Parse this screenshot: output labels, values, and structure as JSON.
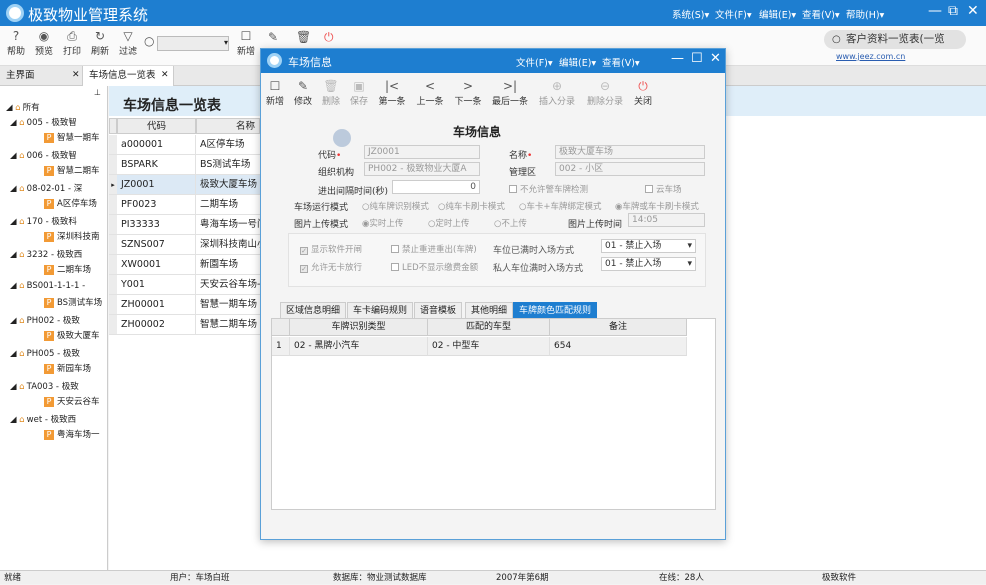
{
  "app": {
    "title": "极致物业管理系统"
  },
  "menu": {
    "system": "系统(S)▾",
    "file": "文件(F)▾",
    "edit": "编辑(E)▾",
    "view": "查看(V)▾",
    "help": "帮助(H)▾"
  },
  "window_controls": {
    "minimize": "—",
    "restore": "⧉",
    "close": "✕"
  },
  "toolbar": {
    "help": "帮助",
    "preview": "预览",
    "print": "打印",
    "refresh": "刷新",
    "filter": "过滤",
    "new": "新增"
  },
  "customer_search": {
    "label": "客户资料一览表(一览"
  },
  "website": "www.jeez.com.cn",
  "tabs": [
    {
      "label": "主界面"
    },
    {
      "label": "车场信息一览表"
    }
  ],
  "tab_close": "✕",
  "tree": {
    "root": "所有",
    "nodes": [
      {
        "label": "005 - 极致智",
        "child": "智慧一期车"
      },
      {
        "label": "006 - 极致智",
        "child": "智慧二期车"
      },
      {
        "label": "08-02-01 - 深",
        "child": "A区停车场"
      },
      {
        "label": "170 - 极致科",
        "child": "深圳科技南"
      },
      {
        "label": "3232 - 极致西",
        "child": "二期车场"
      },
      {
        "label": "BS001-1-1-1 -",
        "child": "BS测试车场"
      },
      {
        "label": "PH002 - 极致",
        "child": "极致大厦车"
      },
      {
        "label": "PH005 - 极致",
        "child": "新园车场"
      },
      {
        "label": "TA003 - 极致",
        "child": "天安云谷车"
      },
      {
        "label": "wet - 极致西",
        "child": "粤海车场一"
      }
    ]
  },
  "list": {
    "title": "车场信息一览表",
    "columns": [
      "代码",
      "名称"
    ],
    "rows": [
      {
        "code": "a000001",
        "name": "A区停车场"
      },
      {
        "code": "BSPARK",
        "name": "BS测试车场"
      },
      {
        "code": "JZ0001",
        "name": "极致大厦车场"
      },
      {
        "code": "PF0023",
        "name": "二期车场"
      },
      {
        "code": "PI33333",
        "name": "粤海车场一号门"
      },
      {
        "code": "SZNS007",
        "name": "深圳科技南山小"
      },
      {
        "code": "XW0001",
        "name": "新園车场"
      },
      {
        "code": "Y001",
        "name": "天安云谷车场-北"
      },
      {
        "code": "ZH00001",
        "name": "智慧一期车场"
      },
      {
        "code": "ZH00002",
        "name": "智慧二期车场"
      }
    ]
  },
  "dialog": {
    "title": "车场信息",
    "menu": {
      "file": "文件(F)▾",
      "edit": "编辑(E)▾",
      "view": "查看(V)▾"
    },
    "toolbar": {
      "new": "新增",
      "edit": "修改",
      "delete": "删除",
      "save": "保存",
      "first": "第一条",
      "prev": "上一条",
      "next": "下一条",
      "last": "最后一条",
      "insert_cat": "插入分录",
      "delete_cat": "删除分录",
      "close": "关闭"
    },
    "form_title": "车场信息",
    "fields": {
      "code_label": "代码",
      "code_value": "JZ0001",
      "name_label": "名称",
      "name_value": "极致大厦车场",
      "org_label": "组织机构",
      "org_value": "PH002 - 极致物业大厦A",
      "area_label": "管理区",
      "area_value": "002 - 小区",
      "interval_label": "进出间隔时间(秒)",
      "interval_value": "0",
      "no_alarm_label": "不允许警车牌检测",
      "cloud_label": "云车场",
      "mode_label": "车场运行模式",
      "modes": [
        "纯车牌识别模式",
        "纯车卡刷卡模式",
        "车卡+车牌绑定模式",
        "车牌或车卡刷卡模式"
      ],
      "upload_label": "图片上传模式",
      "uploads": [
        "实时上传",
        "定时上传",
        "不上传"
      ],
      "upload_time_label": "图片上传时间",
      "upload_time_value": "14:05",
      "show_software": "显示软件开闸",
      "no_double": "禁止重进重出(车牌)",
      "full_mode_label": "车位已满时入场方式",
      "full_mode_value": "01 - 禁止入场",
      "allow_nocard": "允许无卡放行",
      "led_no_fee": "LED不显示缴费金额",
      "private_full_label": "私人车位满时入场方式",
      "private_full_value": "01 - 禁止入场"
    },
    "subtabs": [
      "区域信息明细",
      "车卡编码规则",
      "语音模板",
      "其他明细",
      "车牌颜色匹配规则"
    ],
    "subgrid": {
      "columns": [
        "车牌识别类型",
        "匹配的车型",
        "备注"
      ],
      "rows": [
        {
          "idx": "1",
          "type": "02 - 黑牌小汽车",
          "car": "02 - 中型车",
          "note": "654"
        }
      ]
    }
  },
  "status": {
    "ready": "就绪",
    "user": "用户：车场白班",
    "db": "数据库：物业测试数据库",
    "period": "2007年第6期",
    "online": "在线：28人",
    "company": "极致软件"
  },
  "colors": {
    "accent": "#1e7ed0",
    "badge": "#f29a35"
  }
}
